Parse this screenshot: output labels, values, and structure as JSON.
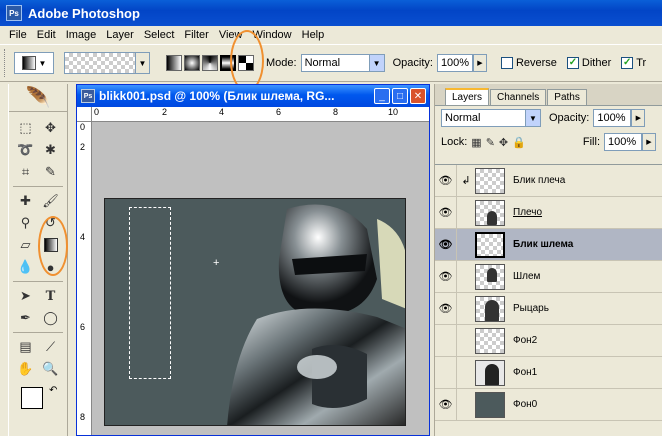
{
  "app": {
    "title": "Adobe Photoshop",
    "logo": "Ps"
  },
  "menu": [
    "File",
    "Edit",
    "Image",
    "Layer",
    "Select",
    "Filter",
    "View",
    "Window",
    "Help"
  ],
  "options": {
    "mode_label": "Mode:",
    "mode_value": "Normal",
    "opacity_label": "Opacity:",
    "opacity_value": "100%",
    "reverse_label": "Reverse",
    "reverse_checked": false,
    "dither_label": "Dither",
    "dither_checked": true,
    "transparency_label": "Tr",
    "transparency_checked": true
  },
  "document": {
    "title": "blikk001.psd @ 100% (Блик шлема, RG...",
    "ruler_h": [
      "0",
      "2",
      "4",
      "6",
      "8",
      "10"
    ],
    "ruler_v": [
      "0",
      "2",
      "4",
      "6",
      "8"
    ]
  },
  "layers_panel": {
    "tabs": [
      "Layers",
      "Channels",
      "Paths"
    ],
    "blend_mode": "Normal",
    "opacity_label": "Opacity:",
    "opacity_value": "100%",
    "lock_label": "Lock:",
    "fill_label": "Fill:",
    "fill_value": "100%",
    "layers": [
      {
        "name": "Блик плеча",
        "visible": true,
        "clipped": true,
        "thumb": "transparent"
      },
      {
        "name": "Плечо",
        "visible": true,
        "clipped": false,
        "thumb": "figure-small",
        "underline": true
      },
      {
        "name": "Блик шлема",
        "visible": true,
        "clipped": false,
        "thumb": "transparent",
        "selected": true
      },
      {
        "name": "Шлем",
        "visible": true,
        "clipped": false,
        "thumb": "figure-small"
      },
      {
        "name": "Рыцарь",
        "visible": true,
        "clipped": false,
        "thumb": "figure"
      },
      {
        "name": "Фон2",
        "visible": false,
        "clipped": false,
        "thumb": "transparent"
      },
      {
        "name": "Фон1",
        "visible": false,
        "clipped": false,
        "thumb": "figure-dark"
      },
      {
        "name": "Фон0",
        "visible": true,
        "clipped": false,
        "thumb": "dark"
      }
    ]
  },
  "colors": {
    "titlebar": "#0a4fd0",
    "highlight_ring": "#f09030",
    "canvas_bg": "#4c5a5c"
  }
}
